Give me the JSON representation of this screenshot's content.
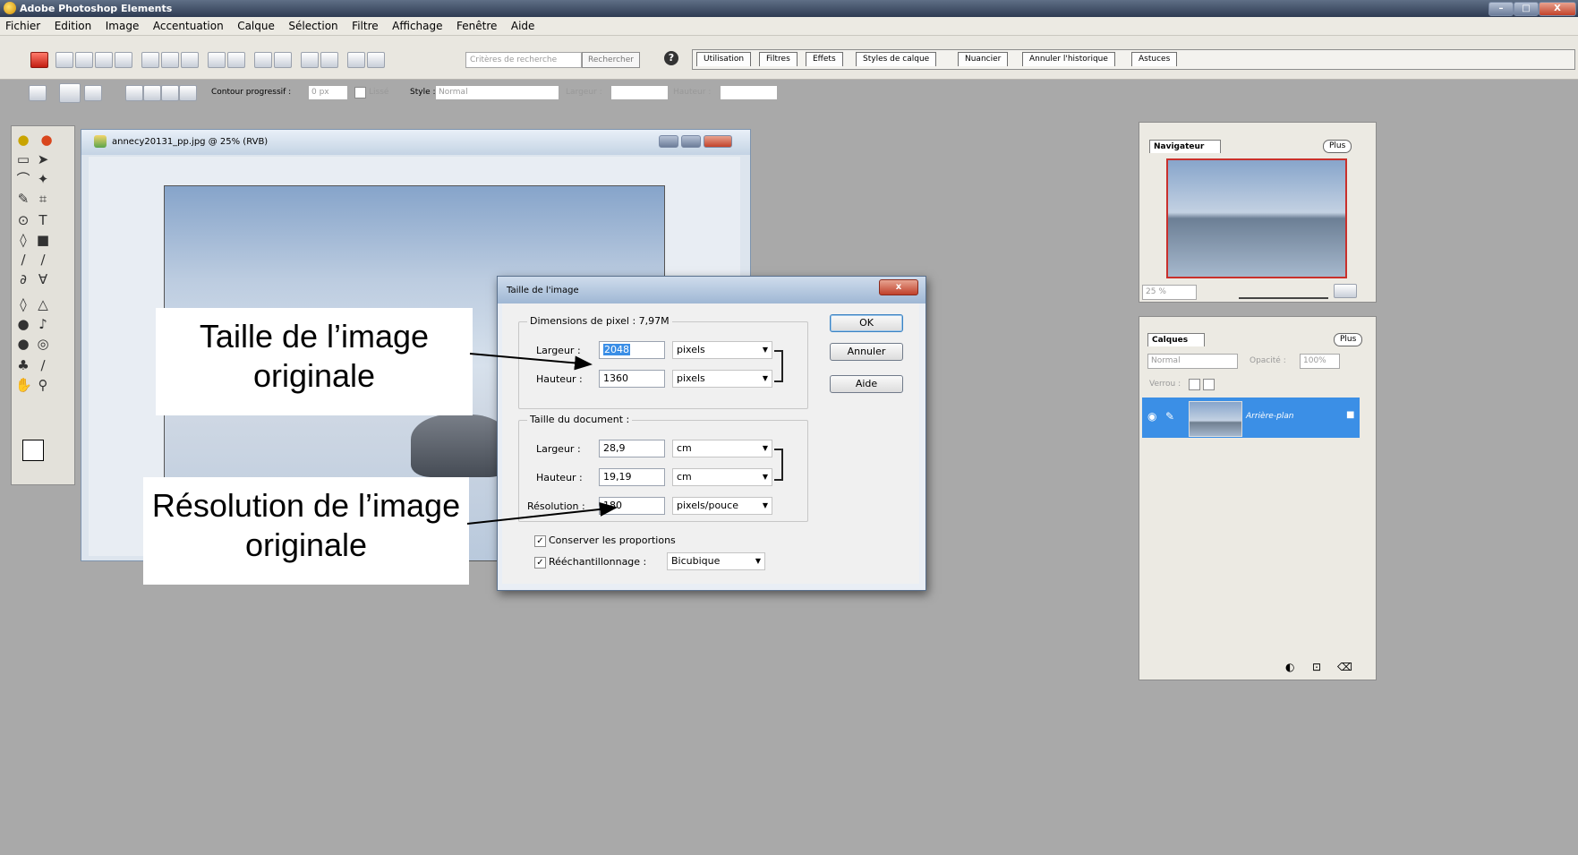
{
  "app": {
    "title": "Adobe Photoshop Elements"
  },
  "window_controls": {
    "minimize": "–",
    "maximize": "□",
    "close": "X"
  },
  "menu": [
    "Fichier",
    "Edition",
    "Image",
    "Accentuation",
    "Calque",
    "Sélection",
    "Filtre",
    "Affichage",
    "Fenêtre",
    "Aide"
  ],
  "toolbar": {
    "search_placeholder": "Critères de recherche",
    "search_button": "Rechercher",
    "help": "?"
  },
  "palette_tabs": [
    "Utilisation",
    "Filtres",
    "Effets",
    "Styles de calque",
    "Nuancier",
    "Annuler l'historique",
    "Astuces"
  ],
  "options_bar": {
    "feather_label": "Contour progressif :",
    "feather_value": "0 px",
    "antialias_label": "Lissé",
    "style_label": "Style :",
    "style_value": "Normal",
    "width_label": "Largeur :",
    "height_label": "Hauteur :"
  },
  "document": {
    "title": "annecy20131_pp.jpg @ 25% (RVB)"
  },
  "dialog": {
    "title": "Taille de l'image",
    "pixel_group": "Dimensions de pixel : 7,97M",
    "px_width_label": "Largeur :",
    "px_width_value": "2048",
    "px_width_unit": "pixels",
    "px_height_label": "Hauteur :",
    "px_height_value": "1360",
    "px_height_unit": "pixels",
    "doc_group": "Taille du document :",
    "doc_width_label": "Largeur :",
    "doc_width_value": "28,9",
    "doc_width_unit": "cm",
    "doc_height_label": "Hauteur :",
    "doc_height_value": "19,19",
    "doc_height_unit": "cm",
    "resolution_label": "Résolution :",
    "resolution_value": "180",
    "resolution_unit": "pixels/pouce",
    "constrain_label": "Conserver les proportions",
    "resample_label": "Rééchantillonnage :",
    "resample_value": "Bicubique",
    "ok": "OK",
    "cancel": "Annuler",
    "help": "Aide"
  },
  "navigator": {
    "tab": "Navigateur",
    "more": "Plus",
    "zoom": "25 %"
  },
  "layers": {
    "tab": "Calques",
    "more": "Plus",
    "blend_mode": "Normal",
    "opacity_label": "Opacité :",
    "opacity_value": "100%",
    "lock_label": "Verrou :",
    "layer_name": "Arrière-plan"
  },
  "annotations": {
    "size_note": "Taille de l’image originale",
    "resolution_note": "Résolution de l’image originale"
  },
  "colors": {
    "accent": "#3b8fe6",
    "dialog_title": "#9fb7d4",
    "workspace": "#a9a9a9"
  }
}
